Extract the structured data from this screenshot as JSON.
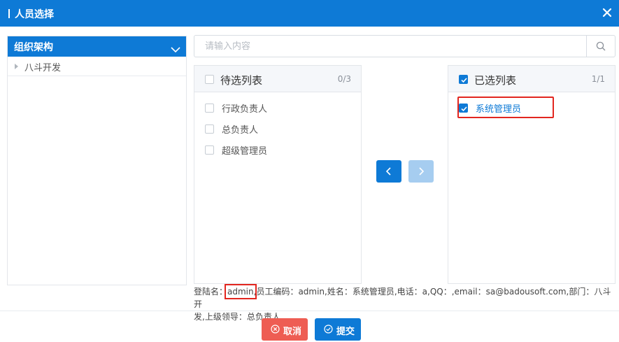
{
  "dialog": {
    "title": "人员选择"
  },
  "org": {
    "header": "组织架构",
    "tree": [
      {
        "label": "八斗开发"
      }
    ]
  },
  "search": {
    "placeholder": "请输入内容",
    "value": ""
  },
  "pending": {
    "title": "待选列表",
    "count": "0/3",
    "all_checked": false,
    "items": [
      {
        "label": "行政负责人",
        "checked": false
      },
      {
        "label": "总负责人",
        "checked": false
      },
      {
        "label": "超级管理员",
        "checked": false
      }
    ]
  },
  "selected": {
    "title": "已选列表",
    "count": "1/1",
    "all_checked": true,
    "items": [
      {
        "label": "系统管理员",
        "checked": true
      }
    ]
  },
  "transfer": {
    "to_left": "left-arrow-icon",
    "to_right": "right-arrow-icon",
    "to_right_disabled": true
  },
  "info": {
    "login_label": "登陆名：",
    "login_value": "admin",
    "rest_line1": ",员工编码：admin,姓名：系统管理员,电话：a,QQ：,email：sa@badousoft.com,部门：八斗开",
    "line2": "发,上级领导：总负责人"
  },
  "actions": {
    "cancel": "取消",
    "submit": "提交"
  },
  "colors": {
    "primary": "#0e7ad6",
    "danger": "#ee5d53",
    "highlight": "#e2261f"
  }
}
